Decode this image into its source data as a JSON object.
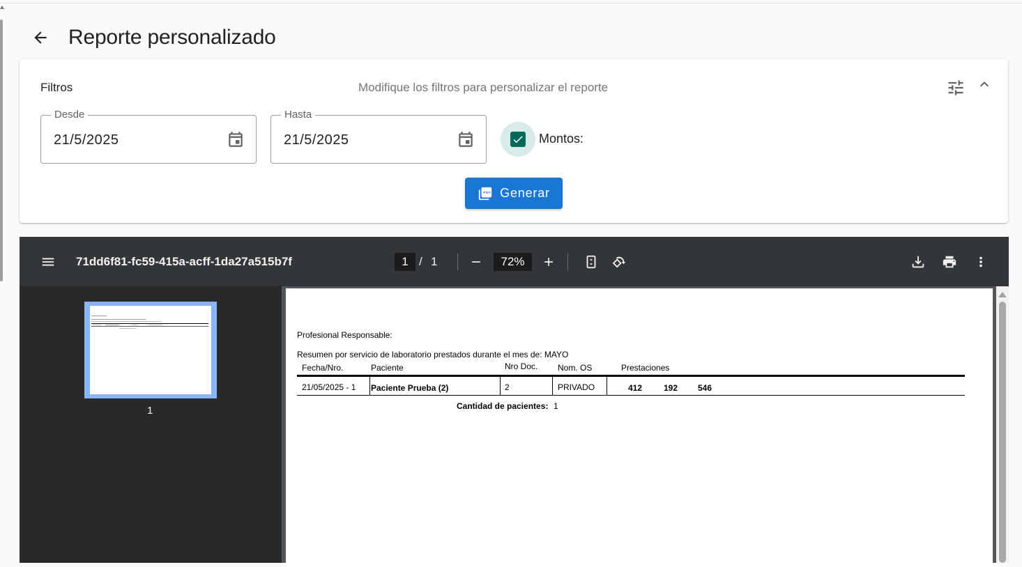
{
  "page": {
    "title": "Reporte personalizado",
    "back_icon": "arrow-left-icon"
  },
  "filters": {
    "title": "Filtros",
    "subtitle": "Modifique los filtros para personalizar el reporte",
    "desde": {
      "label": "Desde",
      "value": "21/5/2025"
    },
    "hasta": {
      "label": "Hasta",
      "value": "21/5/2025"
    },
    "montos": {
      "label": "Montos:",
      "checked": true
    },
    "generate_label": "Generar"
  },
  "colors": {
    "primary": "#1976d2",
    "checkbox": "#00695c",
    "viewer_bg": "#323639"
  },
  "viewer": {
    "filename": "71dd6f81-fc59-415a-acff-1da27a515b7f",
    "current_page": "1",
    "page_separator": "/",
    "total_pages": "1",
    "zoom": "72%",
    "thumbnail_label": "1"
  },
  "report": {
    "profesional_label": "Profesional Responsable:",
    "resumen": "Resumen por servicio de laboratorio prestados durante el mes de: MAYO",
    "columns": [
      "Fecha/Nro.",
      "Paciente",
      "Nro Doc.",
      "Nom. OS",
      "Prestaciones"
    ],
    "rows": [
      {
        "fecha": "21/05/2025 - 1",
        "paciente": "Paciente Prueba (2)",
        "doc": "2",
        "os": "PRIVADO",
        "prestaciones": [
          "412",
          "192",
          "546"
        ]
      }
    ],
    "cantidad_label": "Cantidad de pacientes:",
    "cantidad_value": "1"
  }
}
